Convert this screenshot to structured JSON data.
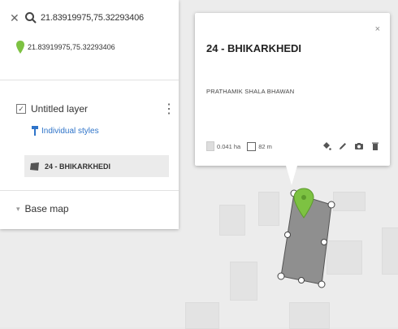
{
  "search": {
    "query": "21.83919975,75.32293406",
    "result": "21.83919975,75.32293406"
  },
  "layer": {
    "name": "Untitled layer",
    "styles_link": "Individual styles",
    "feature": "24 - BHIKARKHEDI"
  },
  "basemap": {
    "label": "Base map"
  },
  "popup": {
    "title": "24 - BHIKARKHEDI",
    "description": "PRATHAMIK SHALA BHAWAN",
    "area": "0.041 ha",
    "perimeter": "82 m",
    "close": "×"
  },
  "colors": {
    "pin": "#7dc242",
    "polygon_fill": "#8f8f8f",
    "link": "#2f74c9"
  },
  "icons": [
    "close-icon",
    "search-icon",
    "map-pin-icon",
    "style-icon",
    "polygon-icon",
    "paint-bucket-icon",
    "edit-icon",
    "camera-icon",
    "delete-icon"
  ]
}
